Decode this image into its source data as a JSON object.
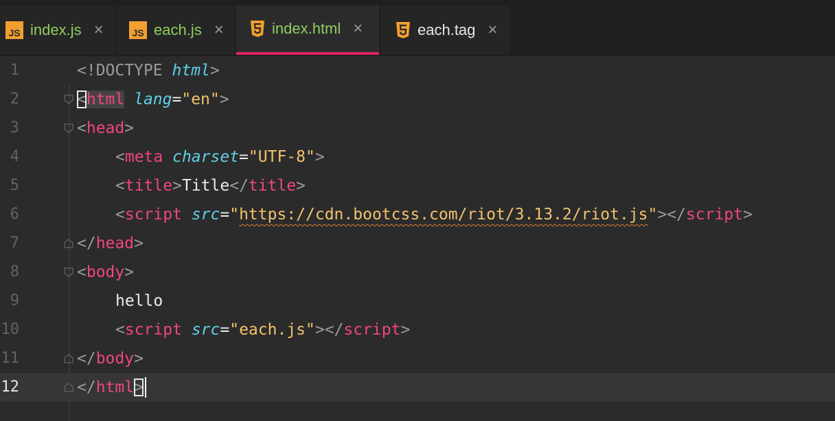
{
  "tabs": [
    {
      "label": "index.js",
      "icon": "js-file-icon",
      "icon_text": "JS",
      "label_color": "#8fcf5f",
      "active": false
    },
    {
      "label": "each.js",
      "icon": "js-file-icon",
      "icon_text": "JS",
      "label_color": "#8fcf5f",
      "active": false
    },
    {
      "label": "index.html",
      "icon": "html5-file-icon",
      "label_color": "#8fcf5f",
      "active": true
    },
    {
      "label": "each.tag",
      "icon": "html5-file-icon",
      "label_color": "#e8e8e8",
      "active": false
    }
  ],
  "close_glyph": "×",
  "accent_color": "#e0245e",
  "current_line": 12,
  "lines": [
    {
      "n": "1"
    },
    {
      "n": "2"
    },
    {
      "n": "3"
    },
    {
      "n": "4"
    },
    {
      "n": "5"
    },
    {
      "n": "6"
    },
    {
      "n": "7"
    },
    {
      "n": "8"
    },
    {
      "n": "9"
    },
    {
      "n": "10"
    },
    {
      "n": "11"
    },
    {
      "n": "12"
    }
  ],
  "tok": {
    "doctype": "!DOCTYPE",
    "html": "html",
    "lang": "lang",
    "en": "\"en\"",
    "head": "head",
    "meta": "meta",
    "charset": "charset",
    "utf8": "\"UTF-8\"",
    "title": "title",
    "title_text": "Title",
    "script": "script",
    "src": "src",
    "cdn_url": "https://cdn.bootcss.com/riot/3.13.2/riot.js",
    "body": "body",
    "hello": "hello",
    "each_js": "\"each.js\""
  }
}
